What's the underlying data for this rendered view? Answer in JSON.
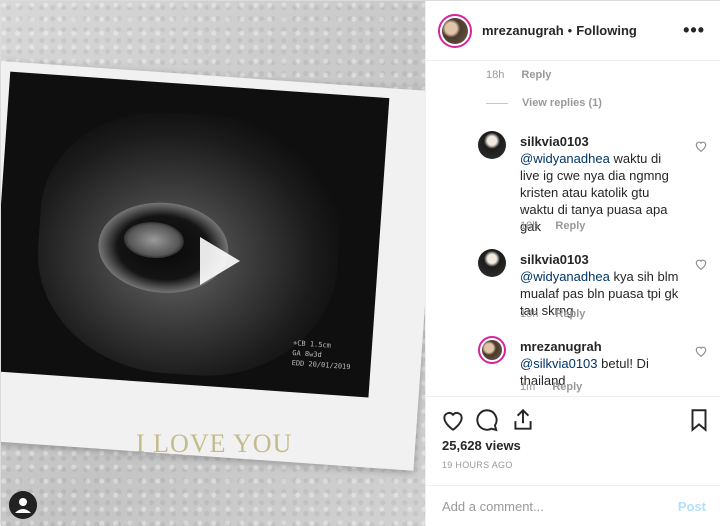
{
  "media": {
    "overlay_text": "I LOVE YOU",
    "scan_text": [
      "+CB 1.5cm",
      "GA 8w3d",
      "EDD 20/01/2019"
    ]
  },
  "header": {
    "username": "mrezanugrah",
    "separator": "•",
    "follow_status": "Following",
    "more_icon": "more-options-icon"
  },
  "top_meta": {
    "time": "18h",
    "reply_label": "Reply"
  },
  "view_replies": "View replies (1)",
  "comments": [
    {
      "username": "silkvia0103",
      "mention": "@widyanadhea",
      "text": "waktu di live ig cwe nya dia ngmng kristen atau katolik gtu waktu di tanya puasa apa gak",
      "time": "18h",
      "reply_label": "Reply"
    },
    {
      "username": "silkvia0103",
      "mention": "@widyanadhea",
      "text": "kya sih blm mualaf pas bln puasa tpi gk tau skrng",
      "time": "18h",
      "reply_label": "Reply"
    },
    {
      "username": "mrezanugrah",
      "mention": "@silkvia0103",
      "text": "betul! Di thailand",
      "time": "1m",
      "reply_label": "Reply"
    }
  ],
  "stats": {
    "views": "25,628 views",
    "posted": "19 HOURS AGO"
  },
  "add_comment": {
    "placeholder": "Add a comment...",
    "post_label": "Post"
  },
  "colors": {
    "story_ring": "#d6249f",
    "link": "#003569",
    "post_disabled": "#b2dffc"
  }
}
